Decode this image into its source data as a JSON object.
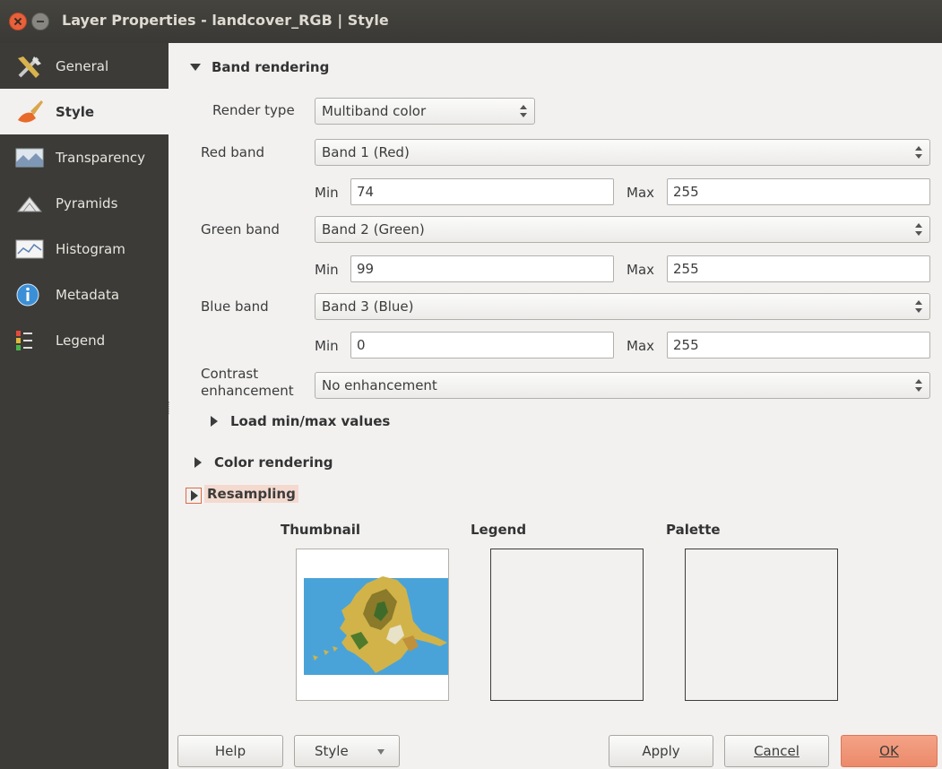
{
  "window": {
    "title": "Layer Properties - landcover_RGB | Style"
  },
  "sidebar": {
    "items": [
      {
        "label": "General",
        "icon": "tools-icon"
      },
      {
        "label": "Style",
        "icon": "paintbrush-icon"
      },
      {
        "label": "Transparency",
        "icon": "transparency-icon"
      },
      {
        "label": "Pyramids",
        "icon": "pyramids-icon"
      },
      {
        "label": "Histogram",
        "icon": "histogram-icon"
      },
      {
        "label": "Metadata",
        "icon": "info-icon"
      },
      {
        "label": "Legend",
        "icon": "legend-icon"
      }
    ],
    "active_index": 1
  },
  "band_rendering": {
    "header": "Band rendering",
    "render_type_label": "Render type",
    "render_type_value": "Multiband color",
    "red_label": "Red band",
    "red_value": "Band 1 (Red)",
    "red_min": "74",
    "red_max": "255",
    "green_label": "Green band",
    "green_value": "Band 2 (Green)",
    "green_min": "99",
    "green_max": "255",
    "blue_label": "Blue band",
    "blue_value": "Band 3 (Blue)",
    "blue_min": "0",
    "blue_max": "255",
    "min_label": "Min",
    "max_label": "Max",
    "contrast_label_line1": "Contrast",
    "contrast_label_line2": "enhancement",
    "contrast_value": "No enhancement",
    "load_minmax": "Load min/max values"
  },
  "color_rendering": {
    "header": "Color rendering"
  },
  "resampling": {
    "header": "Resampling"
  },
  "previews": {
    "thumbnail": "Thumbnail",
    "legend": "Legend",
    "palette": "Palette"
  },
  "buttons": {
    "help": "Help",
    "style": "Style",
    "apply": "Apply",
    "cancel": "Cancel",
    "ok": "OK"
  },
  "colors": {
    "sidebar_bg": "#3c3b37",
    "titlebar_bg": "#3c3b37",
    "ok_button": "#ec8a6a",
    "map_water": "#4aa3d8"
  }
}
